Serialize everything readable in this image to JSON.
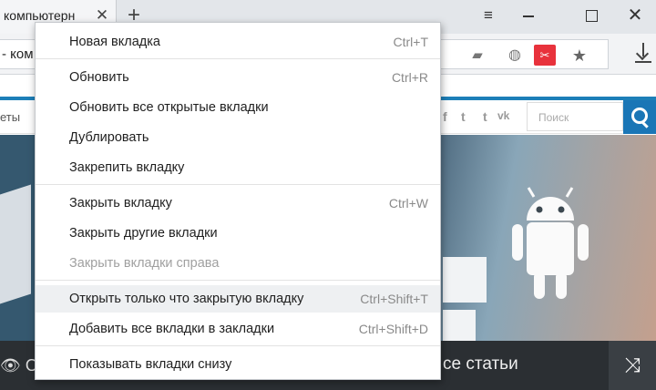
{
  "tabstrip": {
    "tab_title": "компьютерн",
    "tab_close": "✕",
    "new_tab": "+",
    "menu_icon": "≡",
    "close_icon": "✕"
  },
  "toolbar": {
    "address_text": "- ком",
    "ext_flag": "▰",
    "ext_globe": "◍",
    "ext_red": "✂",
    "star": "★"
  },
  "page": {
    "nav_left": "еты",
    "social": [
      "f",
      "t",
      "t",
      "vk"
    ],
    "search_placeholder": "Поиск",
    "bottom_left_icon": "👁 О",
    "bottom_text": "се статьи",
    "shuffle_icon": "⤨"
  },
  "menu": {
    "items": [
      {
        "label": "Новая вкладка",
        "shortcut": "Ctrl+T"
      },
      {
        "label": "Обновить",
        "shortcut": "Ctrl+R"
      },
      {
        "label": "Обновить все открытые вкладки",
        "shortcut": ""
      },
      {
        "label": "Дублировать",
        "shortcut": ""
      },
      {
        "label": "Закрепить вкладку",
        "shortcut": ""
      },
      {
        "label": "Закрыть вкладку",
        "shortcut": "Ctrl+W"
      },
      {
        "label": "Закрыть другие вкладки",
        "shortcut": ""
      },
      {
        "label": "Закрыть вкладки справа",
        "shortcut": ""
      },
      {
        "label": "Открыть только что закрытую вкладку",
        "shortcut": "Ctrl+Shift+T"
      },
      {
        "label": "Добавить все вкладки в закладки",
        "shortcut": "Ctrl+Shift+D"
      },
      {
        "label": "Показывать вкладки снизу",
        "shortcut": ""
      }
    ]
  }
}
